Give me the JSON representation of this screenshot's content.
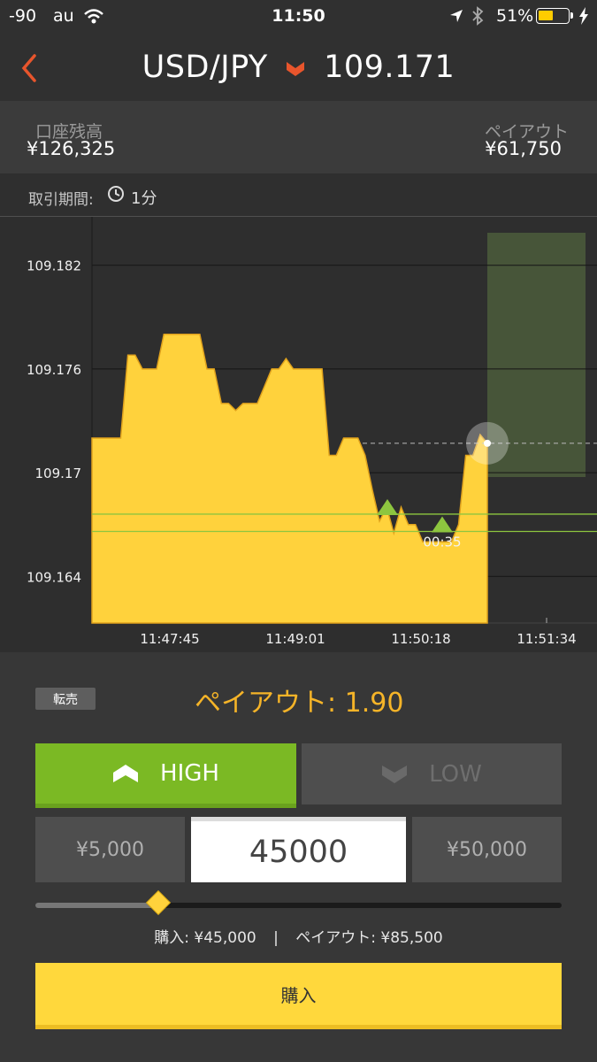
{
  "status_bar": {
    "signal": "-90",
    "carrier": "au",
    "time": "11:50",
    "battery": "51%"
  },
  "header": {
    "pair": "USD/JPY",
    "price": "109.171",
    "direction_icon": "down-arrow-icon",
    "direction_color": "#e8552c"
  },
  "account": {
    "balance_label": "口座残高",
    "balance": "¥126,325",
    "payout_label": "ペイアウト",
    "payout": "¥61,750"
  },
  "period": {
    "label": "取引期間:",
    "value": "1分"
  },
  "chart_data": {
    "type": "area",
    "y_ticks": [
      "109.182",
      "109.176",
      "109.17",
      "109.164"
    ],
    "x_ticks": [
      "11:47:45",
      "11:49:01",
      "11:50:18",
      "11:51:34"
    ],
    "ylim": [
      109.1613,
      109.1848
    ],
    "current_rate": 109.1717,
    "entry_rates": [
      109.1676,
      109.1666
    ],
    "countdown": "00:35",
    "fill_color": "#ffd23c",
    "series": [
      {
        "values": [
          109.172,
          109.172,
          109.172,
          109.172,
          109.172,
          109.1768,
          109.1768,
          109.176,
          109.176,
          109.176,
          109.178,
          109.178,
          109.178,
          109.178,
          109.178,
          109.178,
          109.176,
          109.176,
          109.174,
          109.174,
          109.1736,
          109.174,
          109.174,
          109.174,
          109.175,
          109.176,
          109.176,
          109.1766,
          109.176,
          109.176,
          109.176,
          109.176,
          109.176,
          109.171,
          109.171,
          109.172,
          109.172,
          109.172,
          109.171,
          109.169,
          109.1672,
          109.168,
          109.1665,
          109.168,
          109.167,
          109.167,
          109.166,
          109.166,
          109.166,
          109.166,
          109.166,
          109.167,
          109.171,
          109.171,
          109.1722,
          109.1717
        ]
      }
    ]
  },
  "trade": {
    "resale_label": "転売",
    "payout_rate_text": "ペイアウト: 1.90",
    "high_label": "HIGH",
    "low_label": "LOW",
    "preset_low": "¥5,000",
    "amount": "45000",
    "preset_high": "¥50,000",
    "slider_value": 0.233,
    "summary_purchase": "購入: ¥45,000",
    "summary_separator": "|",
    "summary_payout": "ペイアウト: ¥85,500",
    "buy_label": "購入",
    "colors": {
      "accent": "#f5b428",
      "high_green": "#7bb924",
      "buy_yellow": "#ffd83c"
    }
  }
}
